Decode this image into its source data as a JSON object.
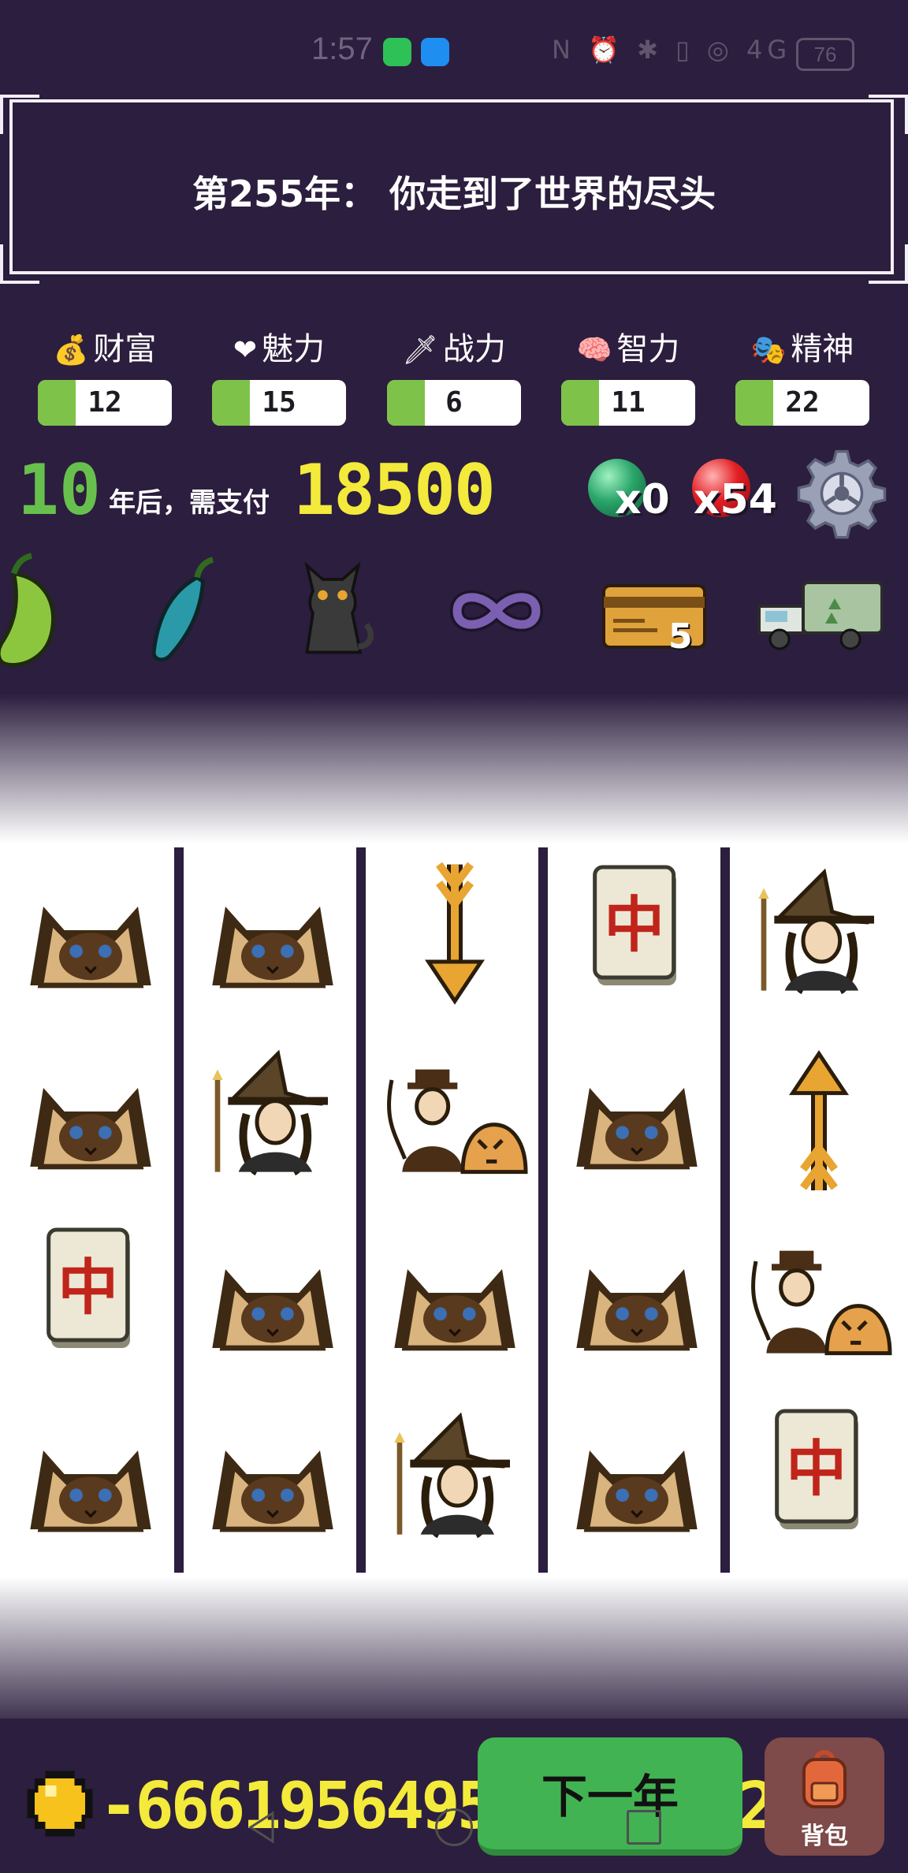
{
  "status_bar": {
    "time": "1:57",
    "right_icons": "N ⏰ ✱ ▯ ◎ 4G",
    "battery": "76"
  },
  "banner": {
    "title": "第255年： 你走到了世界的尽头"
  },
  "stats": [
    {
      "icon": "money-bag-icon",
      "glyph": "💰",
      "label": "财富",
      "value": "12"
    },
    {
      "icon": "heart-icon",
      "glyph": "❤",
      "label": "魅力",
      "value": "15"
    },
    {
      "icon": "sword-icon",
      "glyph": "🗡",
      "label": "战力",
      "value": "6"
    },
    {
      "icon": "brain-icon",
      "glyph": "🧠",
      "label": "智力",
      "value": "11"
    },
    {
      "icon": "theater-mask-icon",
      "glyph": "🎭",
      "label": "精神",
      "value": "22"
    }
  ],
  "payment": {
    "years": "10",
    "years_text": "年后，需支付",
    "amount": "18500"
  },
  "orbs": {
    "green_count": "x0",
    "red_count": "x54"
  },
  "relics": [
    "green-pepper-icon",
    "blue-pepper-icon",
    "black-cat-icon",
    "infinity-icon",
    "credit-card-icon",
    "garbage-truck-icon"
  ],
  "relic_card_badge": "5",
  "grid": {
    "columns": [
      [
        "siamese-cat",
        "siamese-cat",
        "mahjong-zhong",
        "siamese-cat"
      ],
      [
        "siamese-cat",
        "witch",
        "siamese-cat",
        "siamese-cat"
      ],
      [
        "arrow-down",
        "tamer-with-tiger",
        "siamese-cat",
        "witch"
      ],
      [
        "mahjong-zhong",
        "siamese-cat",
        "siamese-cat",
        "siamese-cat"
      ],
      [
        "witch",
        "arrow-up",
        "tamer-with-tiger",
        "mahjong-zhong"
      ]
    ],
    "mahjong_char": "中"
  },
  "bottom": {
    "money": "-6661956495",
    "money_tail": "2",
    "next_year_label": "下一年",
    "bag_label": "背包"
  },
  "colors": {
    "background": "#2c1e3e",
    "stat_green": "#7fc24a",
    "years_green": "#67c04d",
    "money_yellow": "#f3ea3b",
    "next_button": "#42b353",
    "bag_button": "#7e4a4a"
  }
}
